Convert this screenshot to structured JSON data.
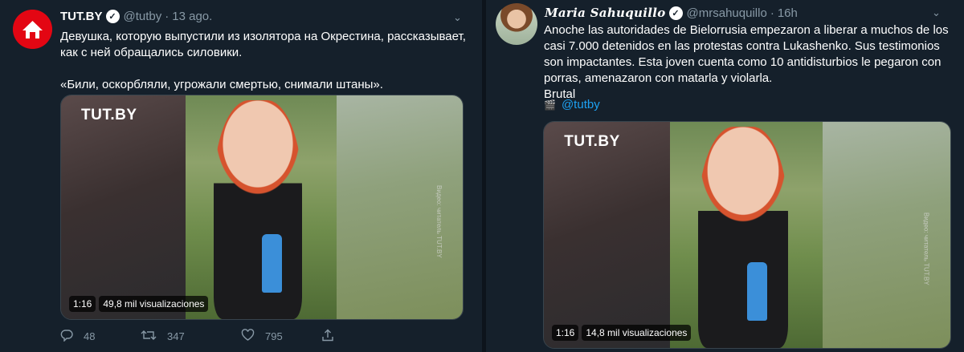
{
  "tweets": [
    {
      "author_name": "TUT.BY",
      "handle": "@tutby",
      "time": "13 ago.",
      "body_lines": [
        "Девушка, которую выпустили из изолятора на Окрестина, рассказывает,",
        "как с ней обращались силовики.",
        "«Били, оскорбляли, угрожали смертью, снимали штаны»."
      ],
      "video": {
        "logo": "TUT.BY",
        "side_caption": "Видео: читатель TUT.BY",
        "duration": "1:16",
        "views": "49,8 mil visualizaciones"
      },
      "actions": {
        "replies": "48",
        "retweets": "347",
        "likes": "795"
      }
    },
    {
      "author_name": "Maria Sahuquillo",
      "handle": "@mrsahuquillo",
      "time": "16h",
      "body_lines": [
        "Anoche las autoridades de Bielorrusia empezaron a liberar a muchos de los",
        "casi 7.000 detenidos en las protestas contra Lukashenko.  Sus testimonios",
        "son impactantes. Esta joven cuenta como 10 antidisturbios le pegaron con",
        "porras, amenazaron con matarla y violarla.",
        "Brutal"
      ],
      "mention": "@tutby",
      "video": {
        "logo": "TUT.BY",
        "side_caption": "Видео: читатель TUT.BY",
        "duration": "1:16",
        "views": "14,8 mil visualizaciones"
      }
    }
  ],
  "icons": {
    "verified": "verified-check-icon",
    "more": "chevron-down-icon",
    "reply": "reply-icon",
    "retweet": "retweet-icon",
    "like": "heart-icon",
    "share": "share-icon",
    "clap": "clapperboard-icon"
  },
  "colors": {
    "background": "#15202b",
    "muted": "#8899a6",
    "link": "#1da1f2",
    "brand_red": "#e30613"
  }
}
